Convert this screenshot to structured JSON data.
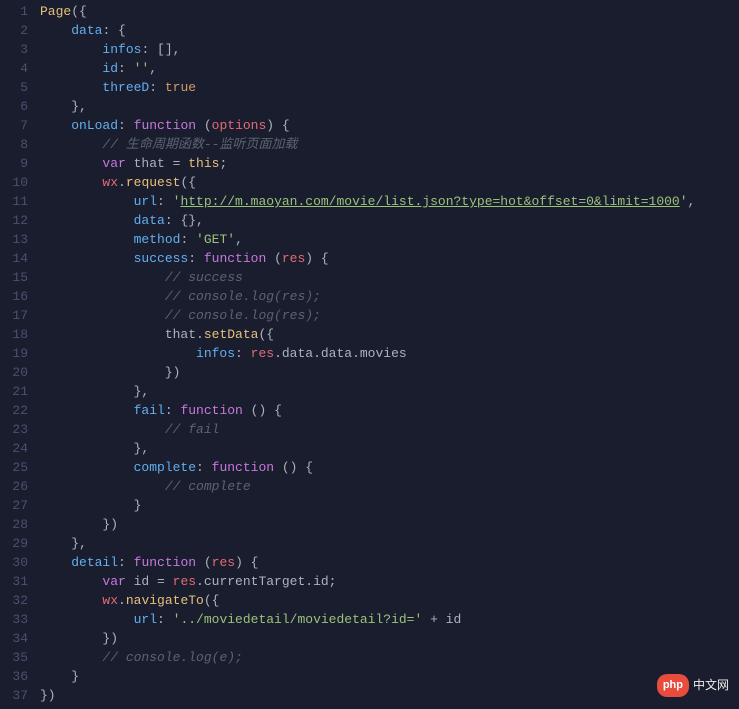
{
  "gutter": {
    "start": 1,
    "end": 37
  },
  "code": {
    "lines": [
      [
        {
          "t": "Page",
          "c": "fn"
        },
        {
          "t": "({",
          "c": "punct"
        }
      ],
      [
        {
          "t": "    "
        },
        {
          "t": "data",
          "c": "prop"
        },
        {
          "t": ": {",
          "c": "punct"
        }
      ],
      [
        {
          "t": "        "
        },
        {
          "t": "infos",
          "c": "prop"
        },
        {
          "t": ": [],",
          "c": "punct"
        }
      ],
      [
        {
          "t": "        "
        },
        {
          "t": "id",
          "c": "prop"
        },
        {
          "t": ": ",
          "c": "punct"
        },
        {
          "t": "''",
          "c": "str"
        },
        {
          "t": ",",
          "c": "punct"
        }
      ],
      [
        {
          "t": "        "
        },
        {
          "t": "threeD",
          "c": "prop"
        },
        {
          "t": ": ",
          "c": "punct"
        },
        {
          "t": "true",
          "c": "bool"
        }
      ],
      [
        {
          "t": "    },",
          "c": "punct"
        }
      ],
      [
        {
          "t": "    "
        },
        {
          "t": "onLoad",
          "c": "prop"
        },
        {
          "t": ": ",
          "c": "punct"
        },
        {
          "t": "function",
          "c": "kw"
        },
        {
          "t": " (",
          "c": "punct"
        },
        {
          "t": "options",
          "c": "id"
        },
        {
          "t": ") {",
          "c": "punct"
        }
      ],
      [
        {
          "t": "        "
        },
        {
          "t": "// 生命周期函数--监听页面加载",
          "c": "cmt"
        }
      ],
      [
        {
          "t": "        "
        },
        {
          "t": "var",
          "c": "kw"
        },
        {
          "t": " that = ",
          "c": "punct"
        },
        {
          "t": "this",
          "c": "this"
        },
        {
          "t": ";",
          "c": "punct"
        }
      ],
      [
        {
          "t": "        "
        },
        {
          "t": "wx",
          "c": "id"
        },
        {
          "t": ".",
          "c": "punct"
        },
        {
          "t": "request",
          "c": "fn"
        },
        {
          "t": "({",
          "c": "punct"
        }
      ],
      [
        {
          "t": "            "
        },
        {
          "t": "url",
          "c": "prop"
        },
        {
          "t": ": ",
          "c": "punct"
        },
        {
          "t": "'",
          "c": "str"
        },
        {
          "t": "http://m.maoyan.com/movie/list.json?type=hot&offset=0&limit=1000",
          "c": "url"
        },
        {
          "t": "'",
          "c": "str"
        },
        {
          "t": ",",
          "c": "punct"
        }
      ],
      [
        {
          "t": "            "
        },
        {
          "t": "data",
          "c": "prop"
        },
        {
          "t": ": {},",
          "c": "punct"
        }
      ],
      [
        {
          "t": "            "
        },
        {
          "t": "method",
          "c": "prop"
        },
        {
          "t": ": ",
          "c": "punct"
        },
        {
          "t": "'GET'",
          "c": "str"
        },
        {
          "t": ",",
          "c": "punct"
        }
      ],
      [
        {
          "t": "            "
        },
        {
          "t": "success",
          "c": "prop"
        },
        {
          "t": ": ",
          "c": "punct"
        },
        {
          "t": "function",
          "c": "kw"
        },
        {
          "t": " (",
          "c": "punct"
        },
        {
          "t": "res",
          "c": "id"
        },
        {
          "t": ") {",
          "c": "punct"
        }
      ],
      [
        {
          "t": "                "
        },
        {
          "t": "// success",
          "c": "cmt"
        }
      ],
      [
        {
          "t": "                "
        },
        {
          "t": "// console.log(res);",
          "c": "cmt"
        }
      ],
      [
        {
          "t": "                "
        },
        {
          "t": "// console.log(res);",
          "c": "cmt"
        }
      ],
      [
        {
          "t": "                "
        },
        {
          "t": "that.",
          "c": "punct"
        },
        {
          "t": "setData",
          "c": "fn"
        },
        {
          "t": "({",
          "c": "punct"
        }
      ],
      [
        {
          "t": "                    "
        },
        {
          "t": "infos",
          "c": "prop"
        },
        {
          "t": ": ",
          "c": "punct"
        },
        {
          "t": "res",
          "c": "id"
        },
        {
          "t": ".data.data.movies",
          "c": "punct"
        }
      ],
      [
        {
          "t": "                })",
          "c": "punct"
        }
      ],
      [
        {
          "t": "            },",
          "c": "punct"
        }
      ],
      [
        {
          "t": "            "
        },
        {
          "t": "fail",
          "c": "prop"
        },
        {
          "t": ": ",
          "c": "punct"
        },
        {
          "t": "function",
          "c": "kw"
        },
        {
          "t": " () {",
          "c": "punct"
        }
      ],
      [
        {
          "t": "                "
        },
        {
          "t": "// fail",
          "c": "cmt"
        }
      ],
      [
        {
          "t": "            },",
          "c": "punct"
        }
      ],
      [
        {
          "t": "            "
        },
        {
          "t": "complete",
          "c": "prop"
        },
        {
          "t": ": ",
          "c": "punct"
        },
        {
          "t": "function",
          "c": "kw"
        },
        {
          "t": " () {",
          "c": "punct"
        }
      ],
      [
        {
          "t": "                "
        },
        {
          "t": "// complete",
          "c": "cmt"
        }
      ],
      [
        {
          "t": "            }",
          "c": "punct"
        }
      ],
      [
        {
          "t": "        })",
          "c": "punct"
        }
      ],
      [
        {
          "t": "    },",
          "c": "punct"
        }
      ],
      [
        {
          "t": "    "
        },
        {
          "t": "detail",
          "c": "prop"
        },
        {
          "t": ": ",
          "c": "punct"
        },
        {
          "t": "function",
          "c": "kw"
        },
        {
          "t": " (",
          "c": "punct"
        },
        {
          "t": "res",
          "c": "id"
        },
        {
          "t": ") {",
          "c": "punct"
        }
      ],
      [
        {
          "t": "        "
        },
        {
          "t": "var",
          "c": "kw"
        },
        {
          "t": " id = ",
          "c": "punct"
        },
        {
          "t": "res",
          "c": "id"
        },
        {
          "t": ".currentTarget.id;",
          "c": "punct"
        }
      ],
      [
        {
          "t": "        "
        },
        {
          "t": "wx",
          "c": "id"
        },
        {
          "t": ".",
          "c": "punct"
        },
        {
          "t": "navigateTo",
          "c": "fn"
        },
        {
          "t": "({",
          "c": "punct"
        }
      ],
      [
        {
          "t": "            "
        },
        {
          "t": "url",
          "c": "prop"
        },
        {
          "t": ": ",
          "c": "punct"
        },
        {
          "t": "'../moviedetail/moviedetail?id='",
          "c": "str"
        },
        {
          "t": " + id",
          "c": "punct"
        }
      ],
      [
        {
          "t": "        })",
          "c": "punct"
        }
      ],
      [
        {
          "t": "        "
        },
        {
          "t": "// console.log(e);",
          "c": "cmt"
        }
      ],
      [
        {
          "t": "    }",
          "c": "punct"
        }
      ],
      [
        {
          "t": "})",
          "c": "punct"
        }
      ]
    ]
  },
  "logo": {
    "bubble": "php",
    "text": "中文网"
  }
}
